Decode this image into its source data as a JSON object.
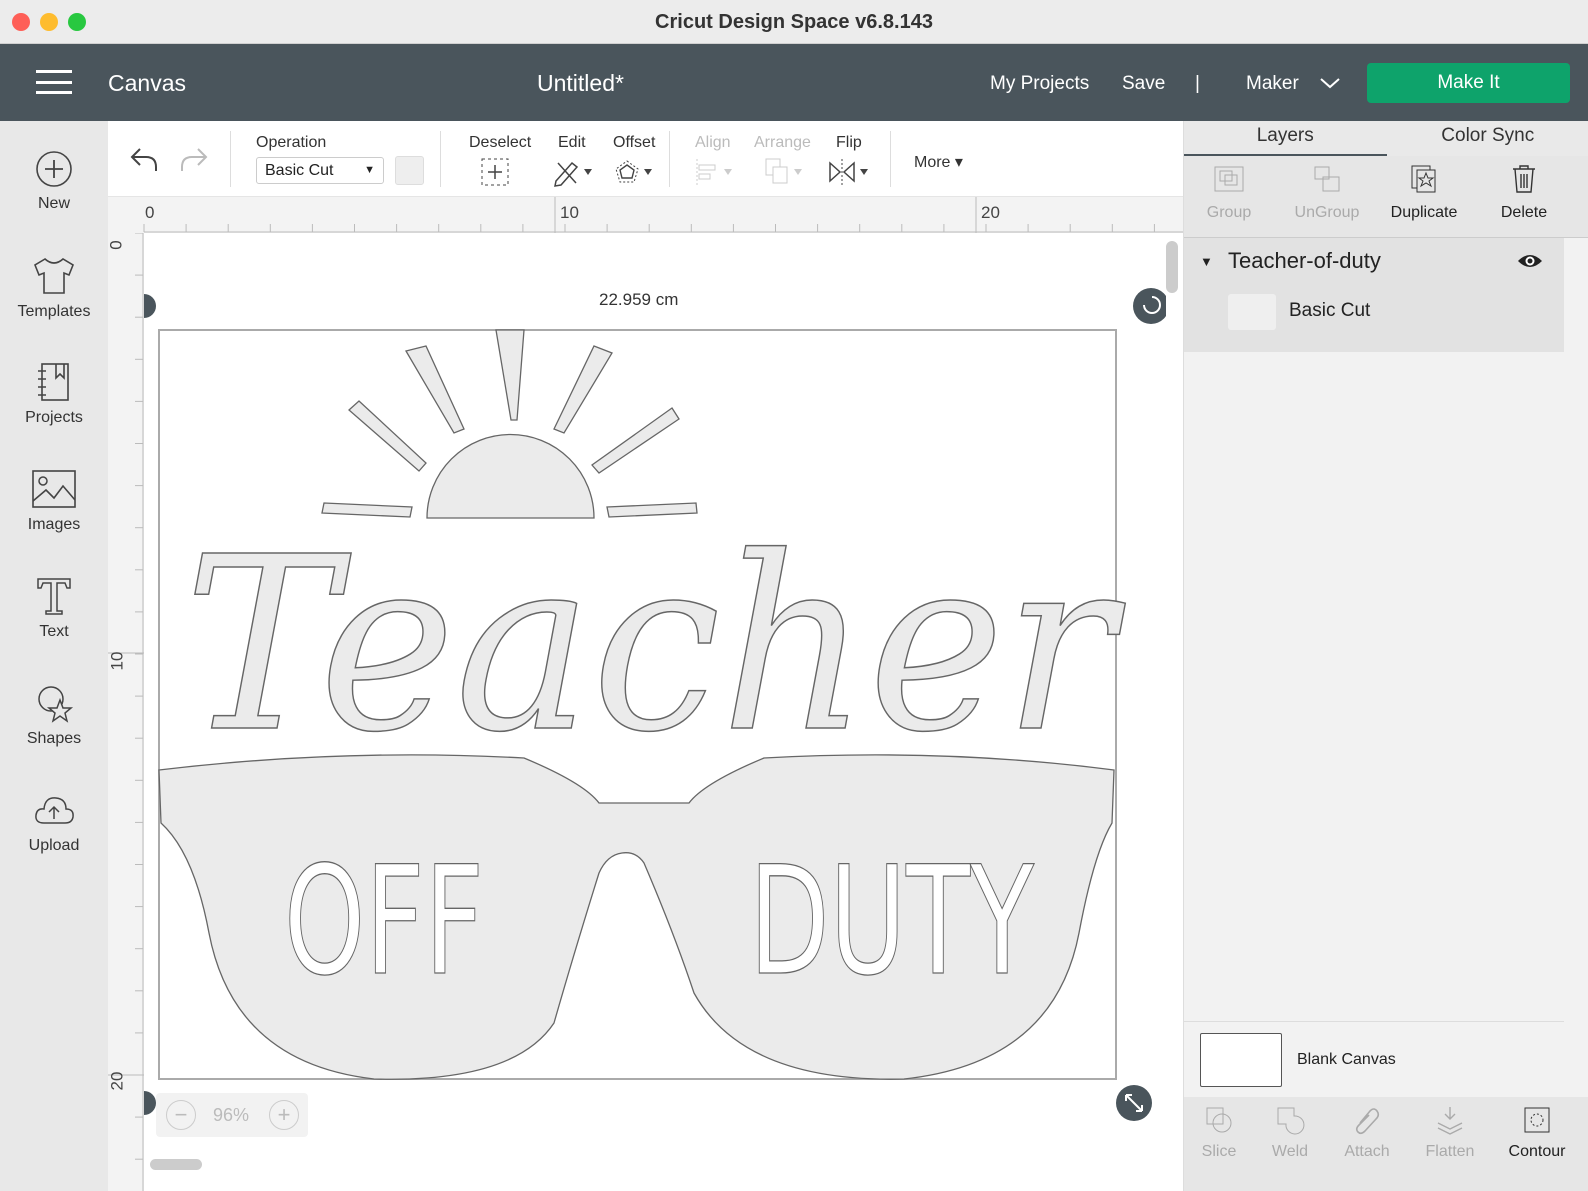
{
  "window": {
    "title": "Cricut Design Space  v6.8.143"
  },
  "header": {
    "section": "Canvas",
    "project_title": "Untitled*",
    "my_projects": "My Projects",
    "save": "Save",
    "divider": "|",
    "machine": "Maker",
    "make_it": "Make It",
    "make_it_color": "#0ea36b"
  },
  "sidebar": {
    "items": [
      {
        "label": "New",
        "icon": "plus-circle-icon"
      },
      {
        "label": "Templates",
        "icon": "tshirt-icon"
      },
      {
        "label": "Projects",
        "icon": "notebook-icon"
      },
      {
        "label": "Images",
        "icon": "image-icon"
      },
      {
        "label": "Text",
        "icon": "text-icon"
      },
      {
        "label": "Shapes",
        "icon": "shapes-icon"
      },
      {
        "label": "Upload",
        "icon": "cloud-upload-icon"
      }
    ]
  },
  "toolbar": {
    "operation_label": "Operation",
    "operation_value": "Basic Cut",
    "deselect": "Deselect",
    "edit": "Edit",
    "offset": "Offset",
    "align": "Align",
    "arrange": "Arrange",
    "flip": "Flip",
    "more": "More"
  },
  "rulers": {
    "horizontal": [
      "0",
      "10",
      "20"
    ],
    "vertical": [
      "0",
      "10",
      "20"
    ]
  },
  "canvas": {
    "width_label": "22.959 cm",
    "zoom": "96%",
    "artwork": {
      "word1": "Teacher",
      "word2": "OFF",
      "word3": "DUTY"
    }
  },
  "layers_panel": {
    "tabs": [
      "Layers",
      "Color Sync"
    ],
    "tools": {
      "group": "Group",
      "ungroup": "UnGroup",
      "duplicate": "Duplicate",
      "delete": "Delete"
    },
    "group_name": "Teacher-of-duty",
    "layer_name": "Basic Cut",
    "blank_canvas": "Blank Canvas",
    "bottom_tools": {
      "slice": "Slice",
      "weld": "Weld",
      "attach": "Attach",
      "flatten": "Flatten",
      "contour": "Contour"
    }
  }
}
